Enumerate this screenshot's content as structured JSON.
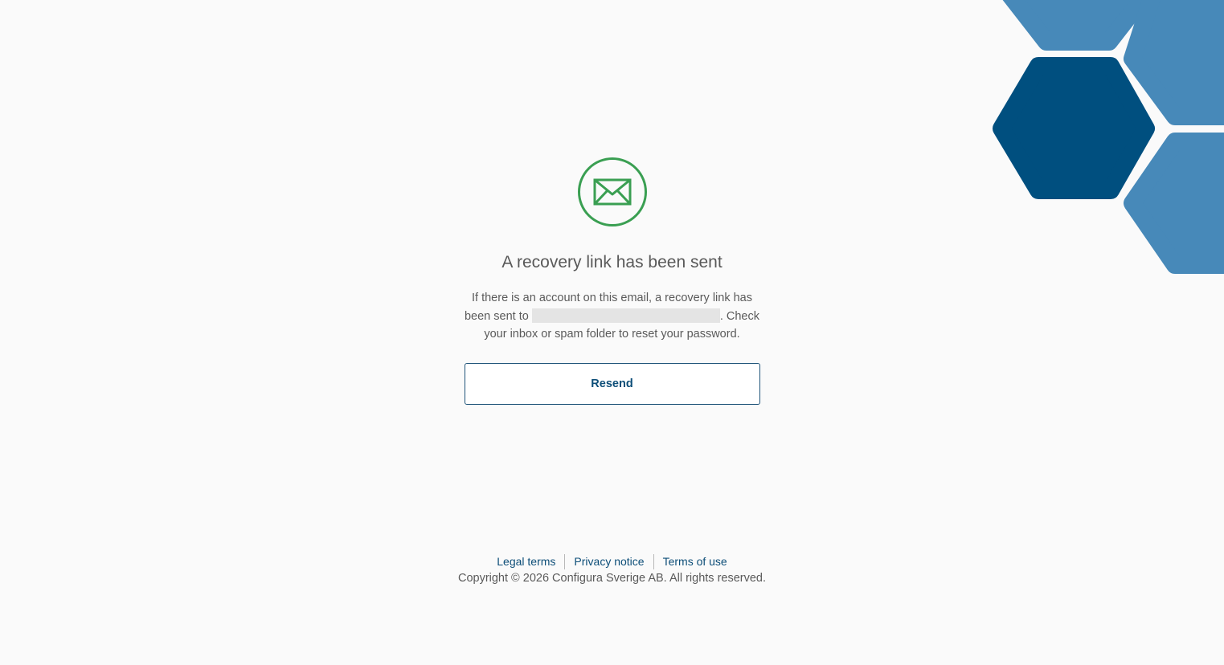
{
  "theme": {
    "success_color": "#3a9f52",
    "link_color": "#0d4e78",
    "hex_dark": "#004f7f",
    "hex_light": "#4789b9"
  },
  "icon": {
    "name": "envelope-icon"
  },
  "heading": "A recovery link has been sent",
  "message": {
    "before": "If there is an account on this email, a recovery link has been sent to",
    "after": ". Check your inbox or spam folder to reset your password."
  },
  "resend_label": "Resend",
  "footer": {
    "links": [
      "Legal terms",
      "Privacy notice",
      "Terms of use"
    ],
    "copyright": "Copyright © 2026 Configura Sverige AB. All rights reserved."
  }
}
